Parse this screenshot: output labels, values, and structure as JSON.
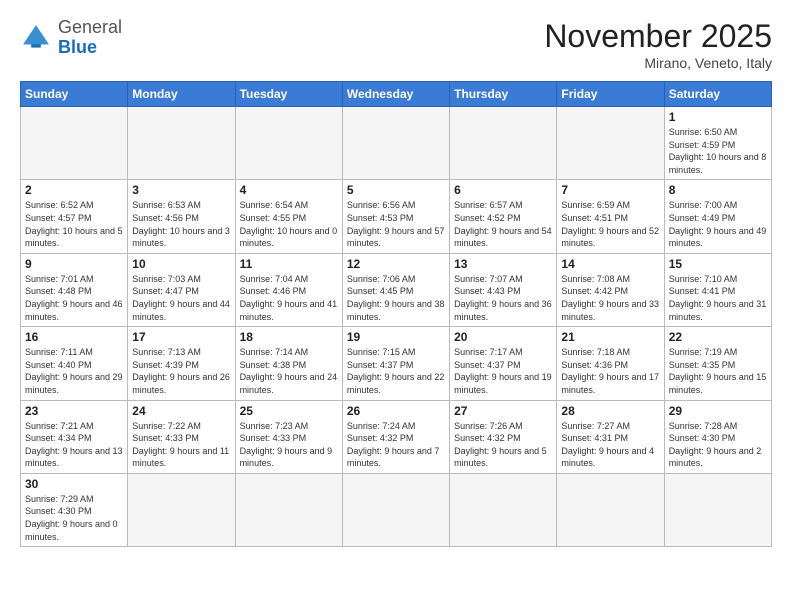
{
  "header": {
    "logo_general": "General",
    "logo_blue": "Blue",
    "month_title": "November 2025",
    "subtitle": "Mirano, Veneto, Italy"
  },
  "weekdays": [
    "Sunday",
    "Monday",
    "Tuesday",
    "Wednesday",
    "Thursday",
    "Friday",
    "Saturday"
  ],
  "weeks": [
    [
      {
        "day": "",
        "info": ""
      },
      {
        "day": "",
        "info": ""
      },
      {
        "day": "",
        "info": ""
      },
      {
        "day": "",
        "info": ""
      },
      {
        "day": "",
        "info": ""
      },
      {
        "day": "",
        "info": ""
      },
      {
        "day": "1",
        "info": "Sunrise: 6:50 AM\nSunset: 4:59 PM\nDaylight: 10 hours\nand 8 minutes."
      }
    ],
    [
      {
        "day": "2",
        "info": "Sunrise: 6:52 AM\nSunset: 4:57 PM\nDaylight: 10 hours\nand 5 minutes."
      },
      {
        "day": "3",
        "info": "Sunrise: 6:53 AM\nSunset: 4:56 PM\nDaylight: 10 hours\nand 3 minutes."
      },
      {
        "day": "4",
        "info": "Sunrise: 6:54 AM\nSunset: 4:55 PM\nDaylight: 10 hours\nand 0 minutes."
      },
      {
        "day": "5",
        "info": "Sunrise: 6:56 AM\nSunset: 4:53 PM\nDaylight: 9 hours\nand 57 minutes."
      },
      {
        "day": "6",
        "info": "Sunrise: 6:57 AM\nSunset: 4:52 PM\nDaylight: 9 hours\nand 54 minutes."
      },
      {
        "day": "7",
        "info": "Sunrise: 6:59 AM\nSunset: 4:51 PM\nDaylight: 9 hours\nand 52 minutes."
      },
      {
        "day": "8",
        "info": "Sunrise: 7:00 AM\nSunset: 4:49 PM\nDaylight: 9 hours\nand 49 minutes."
      }
    ],
    [
      {
        "day": "9",
        "info": "Sunrise: 7:01 AM\nSunset: 4:48 PM\nDaylight: 9 hours\nand 46 minutes."
      },
      {
        "day": "10",
        "info": "Sunrise: 7:03 AM\nSunset: 4:47 PM\nDaylight: 9 hours\nand 44 minutes."
      },
      {
        "day": "11",
        "info": "Sunrise: 7:04 AM\nSunset: 4:46 PM\nDaylight: 9 hours\nand 41 minutes."
      },
      {
        "day": "12",
        "info": "Sunrise: 7:06 AM\nSunset: 4:45 PM\nDaylight: 9 hours\nand 38 minutes."
      },
      {
        "day": "13",
        "info": "Sunrise: 7:07 AM\nSunset: 4:43 PM\nDaylight: 9 hours\nand 36 minutes."
      },
      {
        "day": "14",
        "info": "Sunrise: 7:08 AM\nSunset: 4:42 PM\nDaylight: 9 hours\nand 33 minutes."
      },
      {
        "day": "15",
        "info": "Sunrise: 7:10 AM\nSunset: 4:41 PM\nDaylight: 9 hours\nand 31 minutes."
      }
    ],
    [
      {
        "day": "16",
        "info": "Sunrise: 7:11 AM\nSunset: 4:40 PM\nDaylight: 9 hours\nand 29 minutes."
      },
      {
        "day": "17",
        "info": "Sunrise: 7:13 AM\nSunset: 4:39 PM\nDaylight: 9 hours\nand 26 minutes."
      },
      {
        "day": "18",
        "info": "Sunrise: 7:14 AM\nSunset: 4:38 PM\nDaylight: 9 hours\nand 24 minutes."
      },
      {
        "day": "19",
        "info": "Sunrise: 7:15 AM\nSunset: 4:37 PM\nDaylight: 9 hours\nand 22 minutes."
      },
      {
        "day": "20",
        "info": "Sunrise: 7:17 AM\nSunset: 4:37 PM\nDaylight: 9 hours\nand 19 minutes."
      },
      {
        "day": "21",
        "info": "Sunrise: 7:18 AM\nSunset: 4:36 PM\nDaylight: 9 hours\nand 17 minutes."
      },
      {
        "day": "22",
        "info": "Sunrise: 7:19 AM\nSunset: 4:35 PM\nDaylight: 9 hours\nand 15 minutes."
      }
    ],
    [
      {
        "day": "23",
        "info": "Sunrise: 7:21 AM\nSunset: 4:34 PM\nDaylight: 9 hours\nand 13 minutes."
      },
      {
        "day": "24",
        "info": "Sunrise: 7:22 AM\nSunset: 4:33 PM\nDaylight: 9 hours\nand 11 minutes."
      },
      {
        "day": "25",
        "info": "Sunrise: 7:23 AM\nSunset: 4:33 PM\nDaylight: 9 hours\nand 9 minutes."
      },
      {
        "day": "26",
        "info": "Sunrise: 7:24 AM\nSunset: 4:32 PM\nDaylight: 9 hours\nand 7 minutes."
      },
      {
        "day": "27",
        "info": "Sunrise: 7:26 AM\nSunset: 4:32 PM\nDaylight: 9 hours\nand 5 minutes."
      },
      {
        "day": "28",
        "info": "Sunrise: 7:27 AM\nSunset: 4:31 PM\nDaylight: 9 hours\nand 4 minutes."
      },
      {
        "day": "29",
        "info": "Sunrise: 7:28 AM\nSunset: 4:30 PM\nDaylight: 9 hours\nand 2 minutes."
      }
    ],
    [
      {
        "day": "30",
        "info": "Sunrise: 7:29 AM\nSunset: 4:30 PM\nDaylight: 9 hours\nand 0 minutes."
      },
      {
        "day": "",
        "info": ""
      },
      {
        "day": "",
        "info": ""
      },
      {
        "day": "",
        "info": ""
      },
      {
        "day": "",
        "info": ""
      },
      {
        "day": "",
        "info": ""
      },
      {
        "day": "",
        "info": ""
      }
    ]
  ]
}
